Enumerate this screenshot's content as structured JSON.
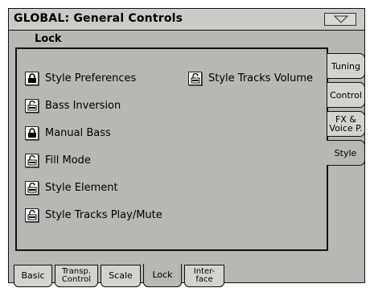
{
  "header": {
    "title": "GLOBAL: General Controls",
    "menu_icon": "triangle-down-icon"
  },
  "section": {
    "label": "Lock"
  },
  "lock_items": [
    {
      "label": "Style Preferences",
      "locked": true
    },
    {
      "label": "Style Tracks Volume",
      "locked": false
    },
    {
      "label": "Bass Inversion",
      "locked": false
    },
    {
      "label": "Manual Bass",
      "locked": true
    },
    {
      "label": "Fill Mode",
      "locked": false
    },
    {
      "label": "Style Element",
      "locked": false
    },
    {
      "label": "Style Tracks Play/Mute",
      "locked": false
    }
  ],
  "side_tabs": [
    {
      "label": "Tuning",
      "active": false
    },
    {
      "label": "Control",
      "active": false
    },
    {
      "label_line1": "FX &",
      "label_line2": "Voice P.",
      "active": false
    },
    {
      "label": "Style",
      "active": true
    }
  ],
  "bottom_tabs": [
    {
      "label": "Basic",
      "active": false
    },
    {
      "label_line1": "Transp.",
      "label_line2": "Control",
      "active": false
    },
    {
      "label": "Scale",
      "active": false
    },
    {
      "label": "Lock",
      "active": true
    },
    {
      "label_line1": "Inter-",
      "label_line2": "face",
      "active": false
    }
  ]
}
